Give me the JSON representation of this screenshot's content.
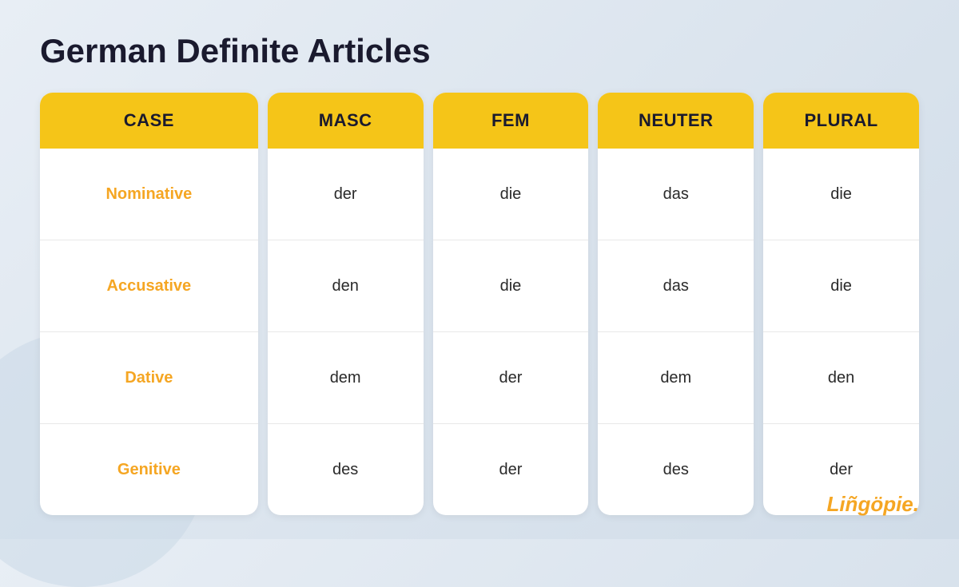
{
  "page": {
    "title": "German Definite Articles",
    "brand": "Liñgöpie."
  },
  "columns": [
    {
      "id": "case",
      "header": "CASE",
      "cells": [
        "Nominative",
        "Accusative",
        "Dative",
        "Genitive"
      ],
      "is_case_col": true
    },
    {
      "id": "masc",
      "header": "MASC",
      "cells": [
        "der",
        "den",
        "dem",
        "des"
      ],
      "is_case_col": false
    },
    {
      "id": "fem",
      "header": "FEM",
      "cells": [
        "die",
        "die",
        "der",
        "der"
      ],
      "is_case_col": false
    },
    {
      "id": "neuter",
      "header": "NEUTER",
      "cells": [
        "das",
        "das",
        "dem",
        "des"
      ],
      "is_case_col": false
    },
    {
      "id": "plural",
      "header": "PLURAL",
      "cells": [
        "die",
        "die",
        "den",
        "der"
      ],
      "is_case_col": false
    }
  ]
}
